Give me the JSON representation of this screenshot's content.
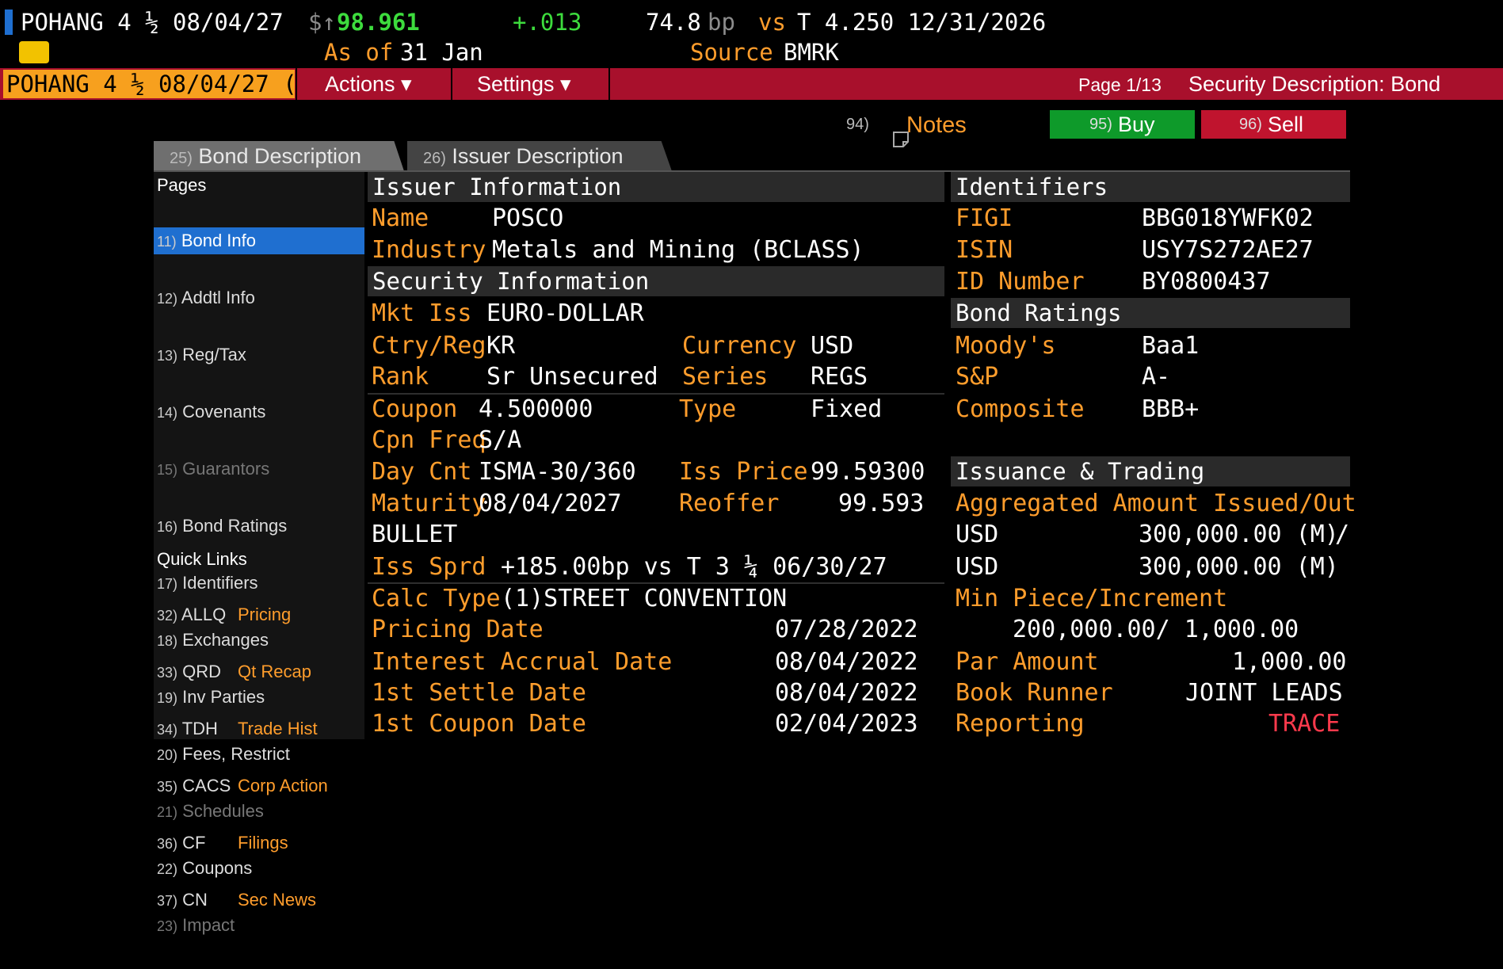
{
  "header": {
    "ticker": "POHANG 4 ½ 08/04/27",
    "price_symbol": "$↑",
    "price": "98.961",
    "change": "+.013",
    "spread": "74.8",
    "spread_unit": "bp",
    "vs_label": "vs",
    "benchmark": "T 4.250 12/31/2026",
    "as_of_label": "As of",
    "as_of_value": "31 Jan",
    "source_label": "Source",
    "source_value": "BMRK"
  },
  "toolbar": {
    "security_field": "POHANG 4 ½ 08/04/27 (",
    "actions_label": "Actions ▾",
    "settings_label": "Settings ▾",
    "page_indicator": "Page 1/13",
    "screen_title": "Security Description: Bond"
  },
  "action_row": {
    "notes_num": "94)",
    "notes_label": "Notes",
    "buy_num": "95)",
    "buy_label": "Buy",
    "sell_num": "96)",
    "sell_label": "Sell"
  },
  "tabs": [
    {
      "num": "25)",
      "label": "Bond Description"
    },
    {
      "num": "26)",
      "label": "Issuer Description"
    }
  ],
  "sidebar": {
    "pages_title": "Pages",
    "pages": [
      {
        "num": "11)",
        "label": "Bond Info"
      },
      {
        "num": "12)",
        "label": "Addtl Info"
      },
      {
        "num": "13)",
        "label": "Reg/Tax"
      },
      {
        "num": "14)",
        "label": "Covenants"
      },
      {
        "num": "15)",
        "label": "Guarantors"
      },
      {
        "num": "16)",
        "label": "Bond Ratings"
      },
      {
        "num": "17)",
        "label": "Identifiers"
      },
      {
        "num": "18)",
        "label": "Exchanges"
      },
      {
        "num": "19)",
        "label": "Inv Parties"
      },
      {
        "num": "20)",
        "label": "Fees, Restrict"
      },
      {
        "num": "21)",
        "label": "Schedules"
      },
      {
        "num": "22)",
        "label": "Coupons"
      },
      {
        "num": "23)",
        "label": "Impact"
      }
    ],
    "quick_links_title": "Quick Links",
    "quick_links": [
      {
        "num": "32)",
        "code": "ALLQ",
        "label": "Pricing"
      },
      {
        "num": "33)",
        "code": "QRD",
        "label": "Qt Recap"
      },
      {
        "num": "34)",
        "code": "TDH",
        "label": "Trade Hist"
      },
      {
        "num": "35)",
        "code": "CACS",
        "label": "Corp Action"
      },
      {
        "num": "36)",
        "code": "CF",
        "label": "Filings"
      },
      {
        "num": "37)",
        "code": "CN",
        "label": "Sec News"
      }
    ]
  },
  "issuer": {
    "title": "Issuer Information",
    "name_label": "Name",
    "name_value": "POSCO",
    "industry_label": "Industry",
    "industry_value": "Metals and Mining (BCLASS)"
  },
  "security": {
    "title": "Security Information",
    "mkt_iss_label": "Mkt Iss",
    "mkt_iss_value": "EURO-DOLLAR",
    "ctry_label": "Ctry/Reg",
    "ctry_value": "KR",
    "currency_label": "Currency",
    "currency_value": "USD",
    "rank_label": "Rank",
    "rank_value": "Sr Unsecured",
    "series_label": "Series",
    "series_value": "REGS",
    "coupon_label": "Coupon",
    "coupon_value": "4.500000",
    "type_label": "Type",
    "type_value": "Fixed",
    "cpn_freq_label": "Cpn Freq",
    "cpn_freq_value": "S/A",
    "day_cnt_label": "Day Cnt",
    "day_cnt_value": "ISMA-30/360",
    "iss_price_label": "Iss Price",
    "iss_price_value": "99.59300",
    "maturity_label": "Maturity",
    "maturity_value": "08/04/2027",
    "reoffer_label": "Reoffer",
    "reoffer_value": "99.593",
    "maturity_type": "BULLET",
    "iss_sprd_label": "Iss Sprd",
    "iss_sprd_value": "+185.00bp vs T 3 ¼ 06/30/27",
    "calc_type_label": "Calc Type",
    "calc_type_value": "(1)STREET CONVENTION",
    "pricing_date_label": "Pricing Date",
    "pricing_date_value": "07/28/2022",
    "accrual_label": "Interest Accrual Date",
    "accrual_value": "08/04/2022",
    "settle_label": "1st Settle Date",
    "settle_value": "08/04/2022",
    "first_coupon_label": "1st Coupon Date",
    "first_coupon_value": "02/04/2023"
  },
  "identifiers": {
    "title": "Identifiers",
    "figi_label": "FIGI",
    "figi_value": "BBG018YWFK02",
    "isin_label": "ISIN",
    "isin_value": "USY7S272AE27",
    "id_label": "ID Number",
    "id_value": "BY0800437"
  },
  "ratings": {
    "title": "Bond Ratings",
    "moodys_label": "Moody's",
    "moodys_value": "Baa1",
    "sp_label": "S&P",
    "sp_value": "A-",
    "composite_label": "Composite",
    "composite_value": "BBB+"
  },
  "issuance": {
    "title": "Issuance & Trading",
    "agg_label": "Aggregated Amount Issued/Out",
    "issued_ccy": "USD",
    "issued_value": "300,000.00 (M)",
    "issued_sep": "/",
    "out_ccy": "USD",
    "out_value": "300,000.00 (M)",
    "min_piece_label": "Min Piece/Increment",
    "min_piece_value": "200,000.00/ 1,000.00",
    "par_label": "Par Amount",
    "par_value": "1,000.00",
    "runner_label": "Book Runner",
    "runner_value": "JOINT LEADS",
    "reporting_label": "Reporting",
    "reporting_value": "TRACE"
  },
  "colors": {
    "background": "#000000",
    "label_orange": "#ff9d2c",
    "toolbar_red": "#a8102c",
    "buy_green": "#0e9a2a",
    "sell_red": "#c0142e",
    "selected_blue": "#1f6fd0",
    "price_green": "#3ddc3d"
  }
}
